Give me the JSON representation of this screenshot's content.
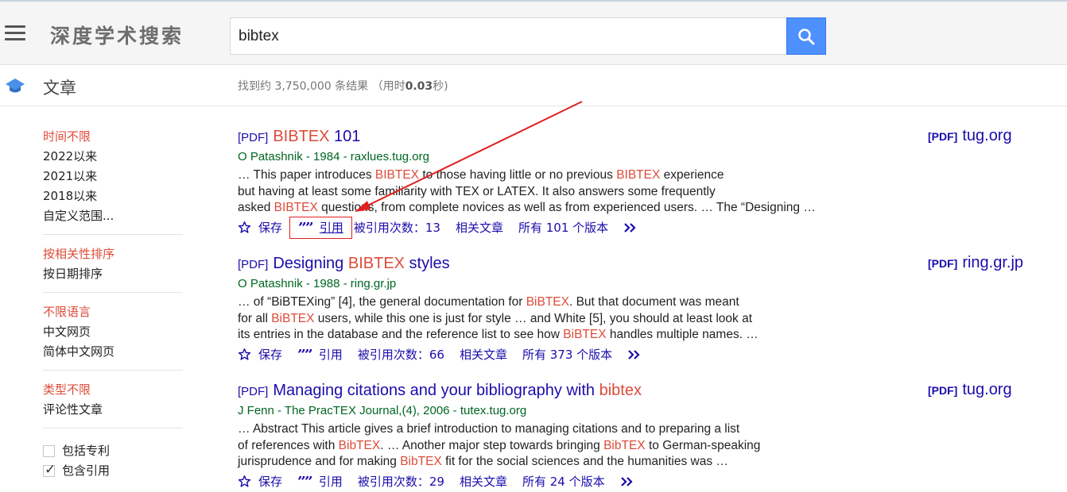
{
  "header": {
    "logo": "深度学术搜索",
    "search_value": "bibtex"
  },
  "subbar": {
    "section": "文章",
    "stats_prefix": "找到约 3,750,000 条结果 （用时",
    "stats_time": "0.03",
    "stats_suffix": "秒)"
  },
  "sidebar": {
    "time": [
      "时间不限",
      "2022以来",
      "2021以来",
      "2018以来",
      "自定义范围..."
    ],
    "sort": [
      "按相关性排序",
      "按日期排序"
    ],
    "lang": [
      "不限语言",
      "中文网页",
      "简体中文网页"
    ],
    "type": [
      "类型不限",
      "评论性文章"
    ],
    "checks": [
      {
        "label": "包括专利",
        "checked": false
      },
      {
        "label": "包含引用",
        "checked": true
      }
    ]
  },
  "actions": {
    "save": "保存",
    "cite": "引用",
    "related": "相关文章"
  },
  "results": [
    {
      "pdf_tag": "[PDF]",
      "title_parts": [
        {
          "t": "BIBTEX",
          "hl": true
        },
        {
          "t": " 101",
          "hl": false
        }
      ],
      "meta": "O Patashnik - 1984 - raxlues.tug.org",
      "snippet": [
        [
          {
            "t": "… This paper introduces ",
            "hl": false
          },
          {
            "t": "BIBTEX",
            "hl": true
          },
          {
            "t": " to those having little or no previous ",
            "hl": false
          },
          {
            "t": "BIBTEX",
            "hl": true
          },
          {
            "t": " experience",
            "hl": false
          }
        ],
        [
          {
            "t": "but having at least some familiarity with TEX or LATEX. It also answers some frequently",
            "hl": false
          }
        ],
        [
          {
            "t": "asked ",
            "hl": false
          },
          {
            "t": "BIBTEX",
            "hl": true
          },
          {
            "t": " questions, from complete novices as well as from experienced users. … The “Designing …",
            "hl": false
          }
        ]
      ],
      "cited_by": "被引用次数：13",
      "versions": "所有 101 个版本",
      "side_pdf": "[PDF]",
      "side_domain": "tug.org"
    },
    {
      "pdf_tag": "[PDF]",
      "title_parts": [
        {
          "t": "Designing ",
          "hl": false
        },
        {
          "t": "BIBTEX",
          "hl": true
        },
        {
          "t": " styles",
          "hl": false
        }
      ],
      "meta": "O Patashnik - 1988 - ring.gr.jp",
      "snippet": [
        [
          {
            "t": "… of “BiBTEXing” [4], the general documentation for ",
            "hl": false
          },
          {
            "t": "BiBTEX",
            "hl": true
          },
          {
            "t": ". But that document was meant",
            "hl": false
          }
        ],
        [
          {
            "t": "for all ",
            "hl": false
          },
          {
            "t": "BiBTEX",
            "hl": true
          },
          {
            "t": " users, while this one is just for style … and White [5], you should at least look at",
            "hl": false
          }
        ],
        [
          {
            "t": "its entries in the database and the reference list to see how ",
            "hl": false
          },
          {
            "t": "BiBTEX",
            "hl": true
          },
          {
            "t": " handles multiple names. …",
            "hl": false
          }
        ]
      ],
      "cited_by": "被引用次数：66",
      "versions": "所有 373 个版本",
      "side_pdf": "[PDF]",
      "side_domain": "ring.gr.jp"
    },
    {
      "pdf_tag": "[PDF]",
      "title_parts": [
        {
          "t": "Managing citations and your bibliography with ",
          "hl": false
        },
        {
          "t": "bibtex",
          "hl": true
        }
      ],
      "meta": "J Fenn - The PracTEX Journal,(4), 2006 - tutex.tug.org",
      "snippet": [
        [
          {
            "t": "… Abstract This article gives a brief introduction to managing citations and to preparing a list",
            "hl": false
          }
        ],
        [
          {
            "t": "of references with ",
            "hl": false
          },
          {
            "t": "BibTEX",
            "hl": true
          },
          {
            "t": ". … Another major step towards bringing ",
            "hl": false
          },
          {
            "t": "BibTEX",
            "hl": true
          },
          {
            "t": " to German-speaking",
            "hl": false
          }
        ],
        [
          {
            "t": "jurisprudence and for making ",
            "hl": false
          },
          {
            "t": "BibTEX",
            "hl": true
          },
          {
            "t": " fit for the social sciences and the humanities was …",
            "hl": false
          }
        ]
      ],
      "cited_by": "被引用次数：29",
      "versions": "所有 24 个版本",
      "side_pdf": "[PDF]",
      "side_domain": "tug.org"
    }
  ],
  "colors": {
    "link": "#1a0dab",
    "highlight": "#dd4b39",
    "meta_green": "#006621",
    "annotation_red": "#e02020",
    "search_button": "#4d90fe"
  }
}
